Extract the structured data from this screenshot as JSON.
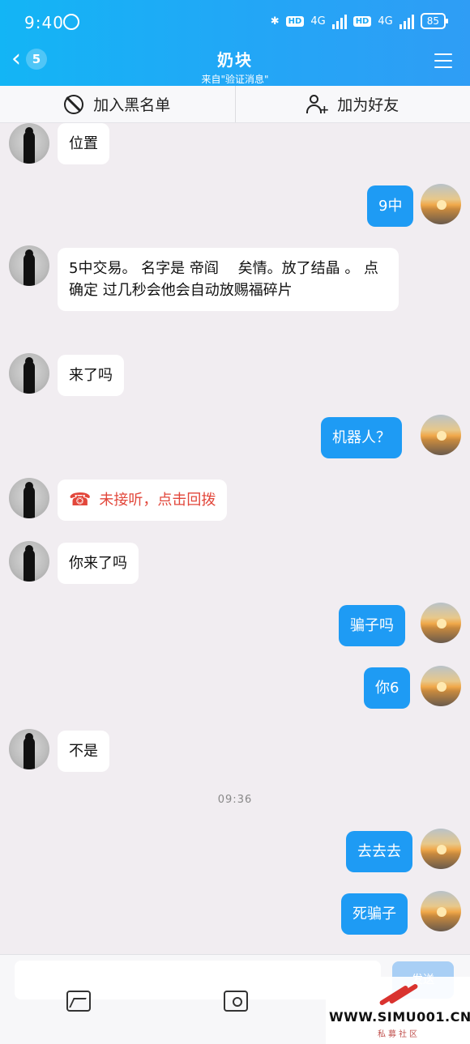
{
  "status_bar": {
    "time": "9:40",
    "network_1": "4G",
    "network_2": "4G",
    "hd_1": "HD",
    "hd_2": "HD",
    "battery": "85"
  },
  "header": {
    "back_count": "5",
    "title": "奶块",
    "subtitle": "来自\"验证消息\""
  },
  "actions": {
    "block_label": "加入黑名单",
    "add_friend_label": "加为好友"
  },
  "messages": [
    {
      "side": "left",
      "text": "位置"
    },
    {
      "side": "right",
      "text": "9中"
    },
    {
      "side": "left",
      "text": "5中交易。 名字是 帝阎 　矣情。放了结晶 。 点确定 过几秒会他会自动放赐福碎片"
    },
    {
      "side": "left",
      "text": "来了吗"
    },
    {
      "side": "right",
      "text": "机器人？"
    },
    {
      "side": "left",
      "text": "未接听，点击回拨"
    },
    {
      "side": "left",
      "text": "你来了吗"
    },
    {
      "side": "right",
      "text": "骗子吗"
    },
    {
      "side": "right",
      "text": "你6"
    },
    {
      "side": "left",
      "text": "不是"
    },
    {
      "side": "right",
      "text": "去去去"
    },
    {
      "side": "right",
      "text": "死骗子"
    }
  ],
  "timestamp": "09:36",
  "input": {
    "placeholder": "",
    "send_label": "发送"
  },
  "watermark": {
    "site": "WWW.SIMU001.CN",
    "sub": "私募社区"
  },
  "colors": {
    "header": "#1aa8f5",
    "bubble_self": "#1e9bf4",
    "bubble_other": "#ffffff",
    "missed_call": "#e2473b",
    "background": "#f1edf1"
  },
  "icons": [
    "back-icon",
    "menu-icon",
    "block-icon",
    "add-friend-icon",
    "phone-icon",
    "image-icon",
    "camera-icon"
  ]
}
